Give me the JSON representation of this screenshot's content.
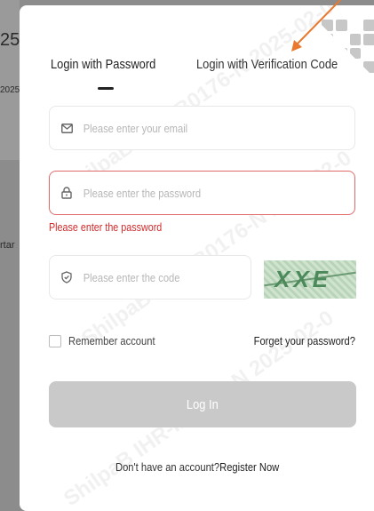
{
  "background": {
    "fragment_1": "25",
    "fragment_2": "2025",
    "fragment_3": "rtar"
  },
  "watermark": {
    "text": "ShilpaB IHR-IB0176-N 2025-02-0"
  },
  "tabs": [
    {
      "label": "Login with Password",
      "active": true
    },
    {
      "label": "Login with Verification Code",
      "active": false
    }
  ],
  "email": {
    "placeholder": "Please enter your email",
    "value": "",
    "icon": "envelope-icon"
  },
  "password": {
    "placeholder": "Please enter the password",
    "value": "",
    "icon": "lock-icon",
    "error": "Please enter the password"
  },
  "code": {
    "placeholder": "Please enter the code",
    "value": "",
    "icon": "shield-icon"
  },
  "captcha": {
    "text": "XXE"
  },
  "remember": {
    "label": "Remember account",
    "checked": false
  },
  "forget_label": "Forget your password?",
  "login_label": "Log In",
  "register": {
    "prompt": "Don't have an account?",
    "link": "Register Now"
  },
  "colors": {
    "error": "#d22b2b",
    "button_disabled": "#c9c9c9",
    "annotation_arrow": "#e8792f"
  }
}
